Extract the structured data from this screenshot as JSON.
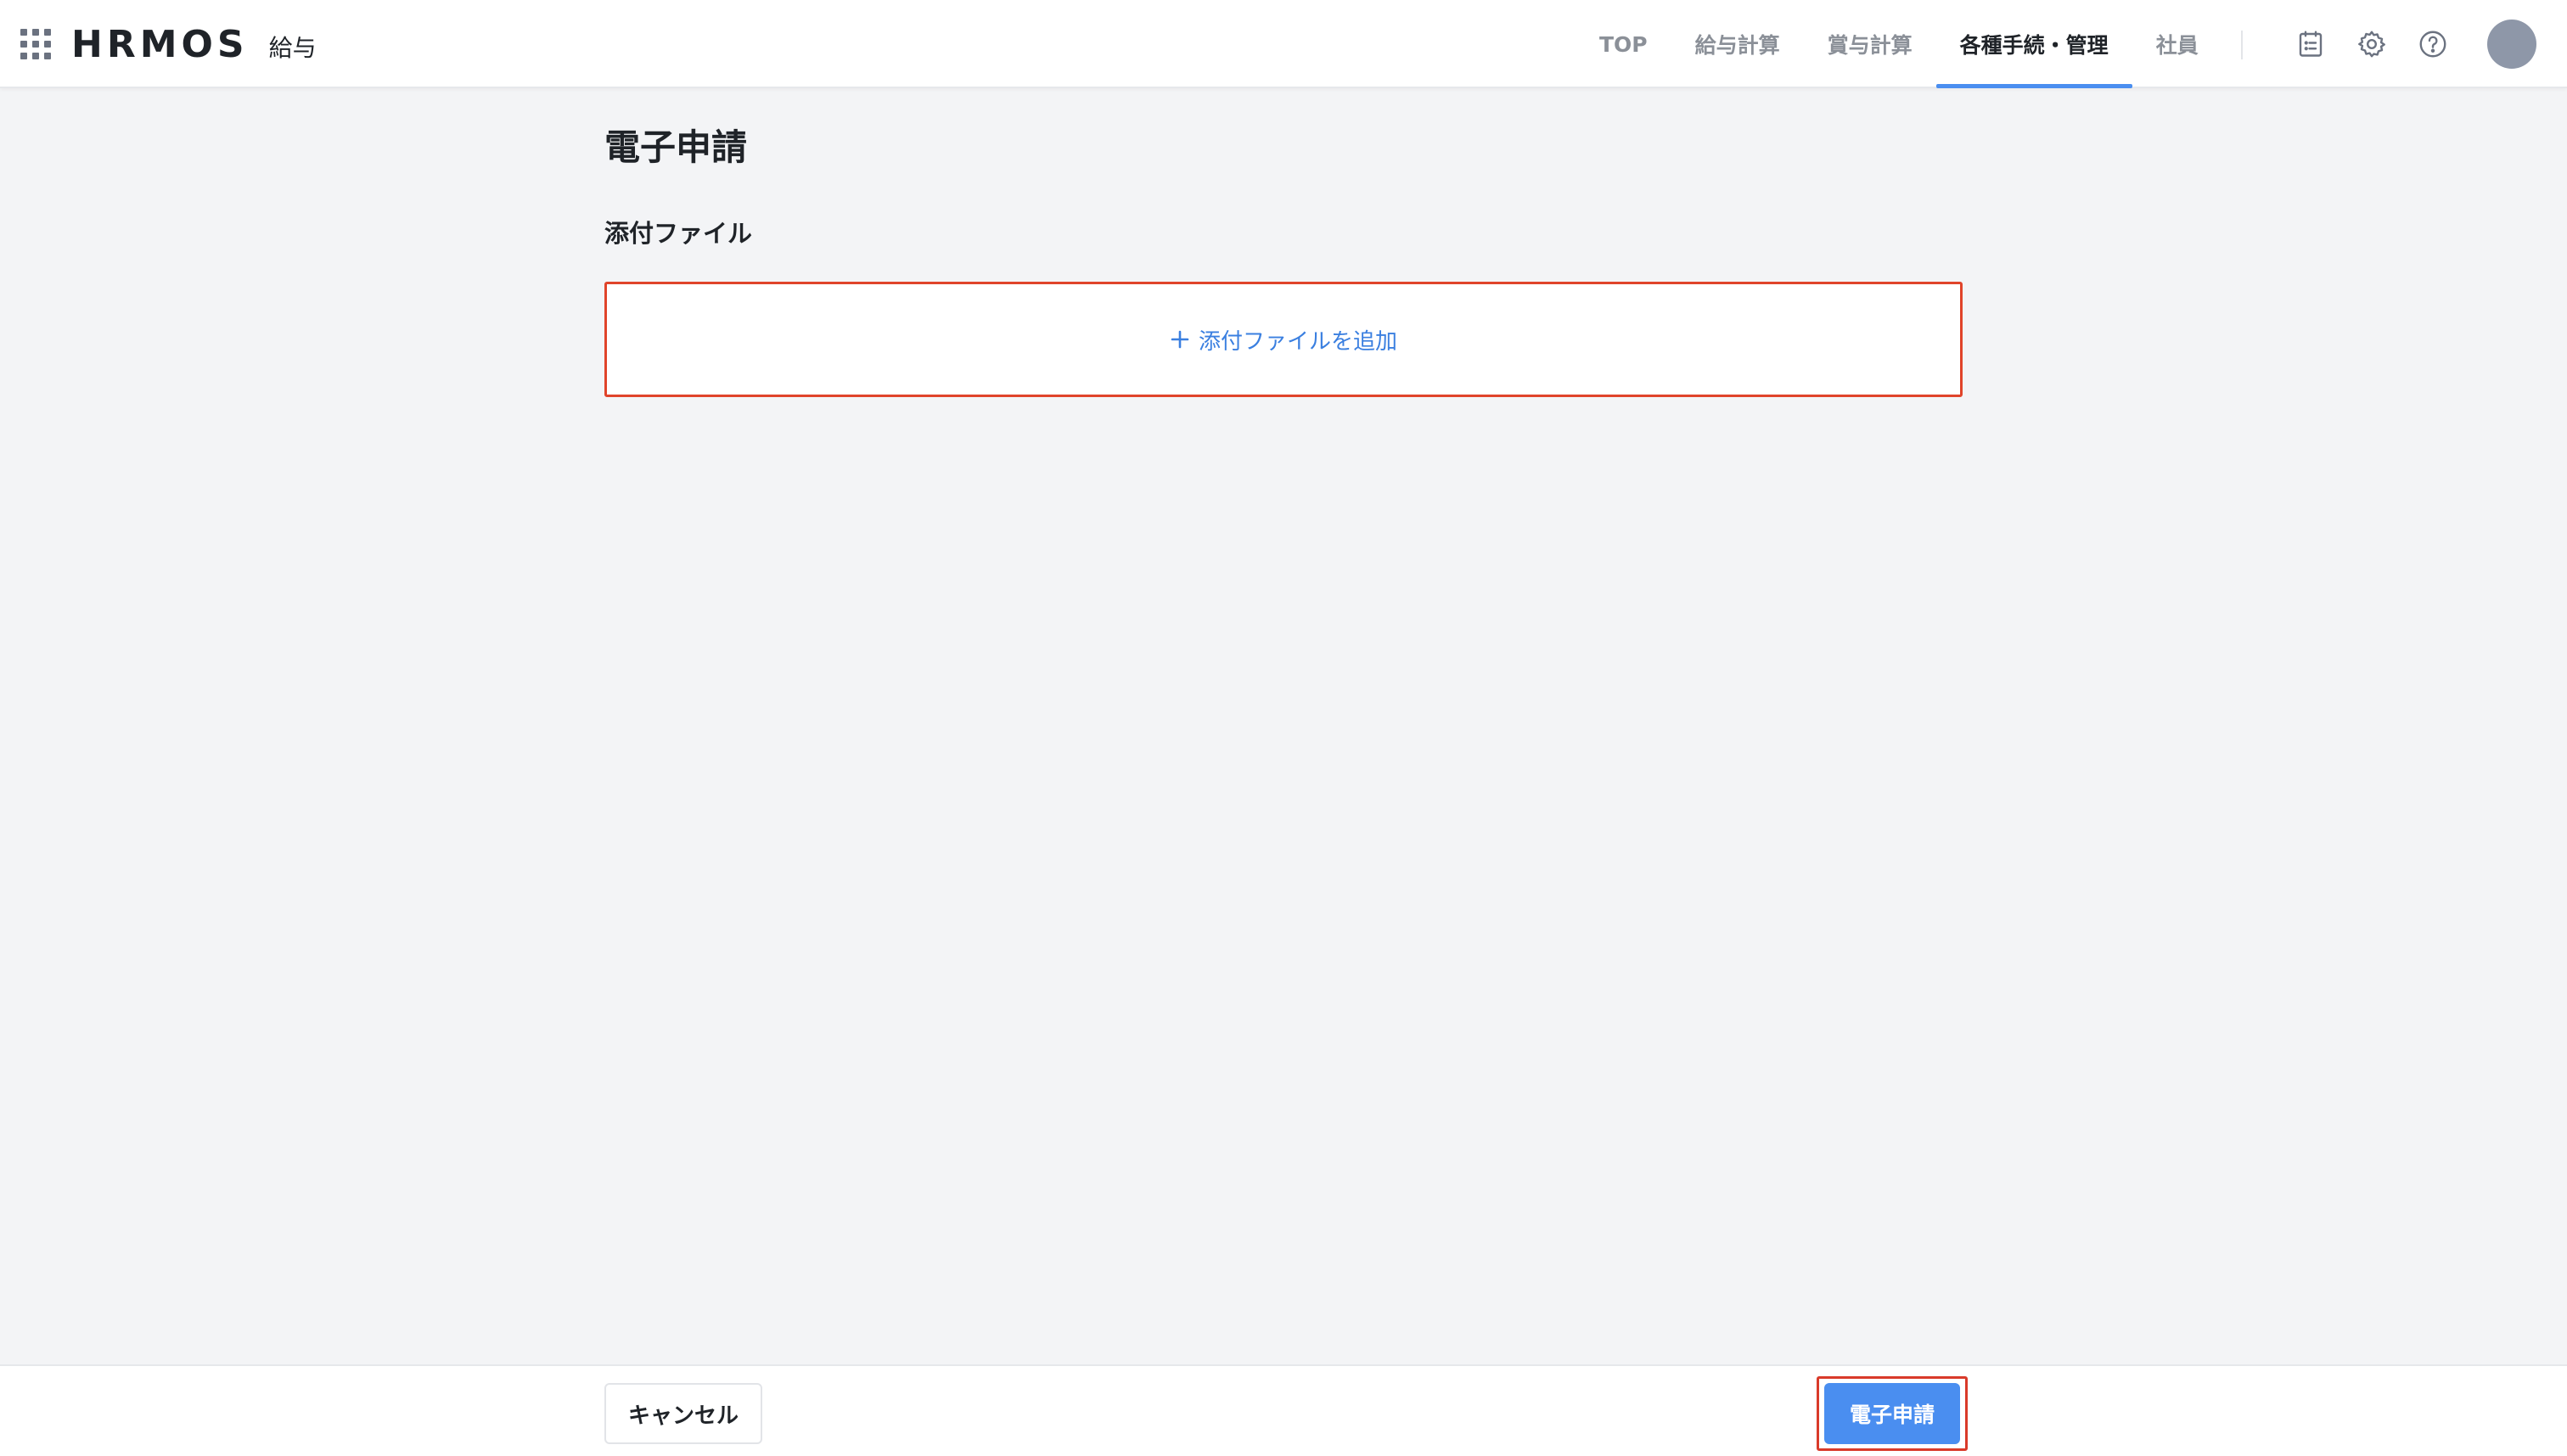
{
  "header": {
    "logo_text": "HRMOS",
    "product_name": "給与",
    "nav": [
      {
        "label": "TOP",
        "active": false
      },
      {
        "label": "給与計算",
        "active": false
      },
      {
        "label": "賞与計算",
        "active": false
      },
      {
        "label": "各種手続・管理",
        "active": true
      },
      {
        "label": "社員",
        "active": false
      }
    ],
    "icons": [
      "app-grid-icon",
      "task-list-icon",
      "settings-gear-icon",
      "help-circle-icon"
    ]
  },
  "main": {
    "page_title": "電子申請",
    "attachments": {
      "section_title": "添付ファイル",
      "add_label": "添付ファイルを追加"
    }
  },
  "footer": {
    "cancel_label": "キャンセル",
    "submit_label": "電子申請"
  },
  "colors": {
    "accent": "#4a8ef0",
    "link": "#3a7fe0",
    "highlight_border": "#e0442b",
    "background": "#f3f4f6"
  }
}
